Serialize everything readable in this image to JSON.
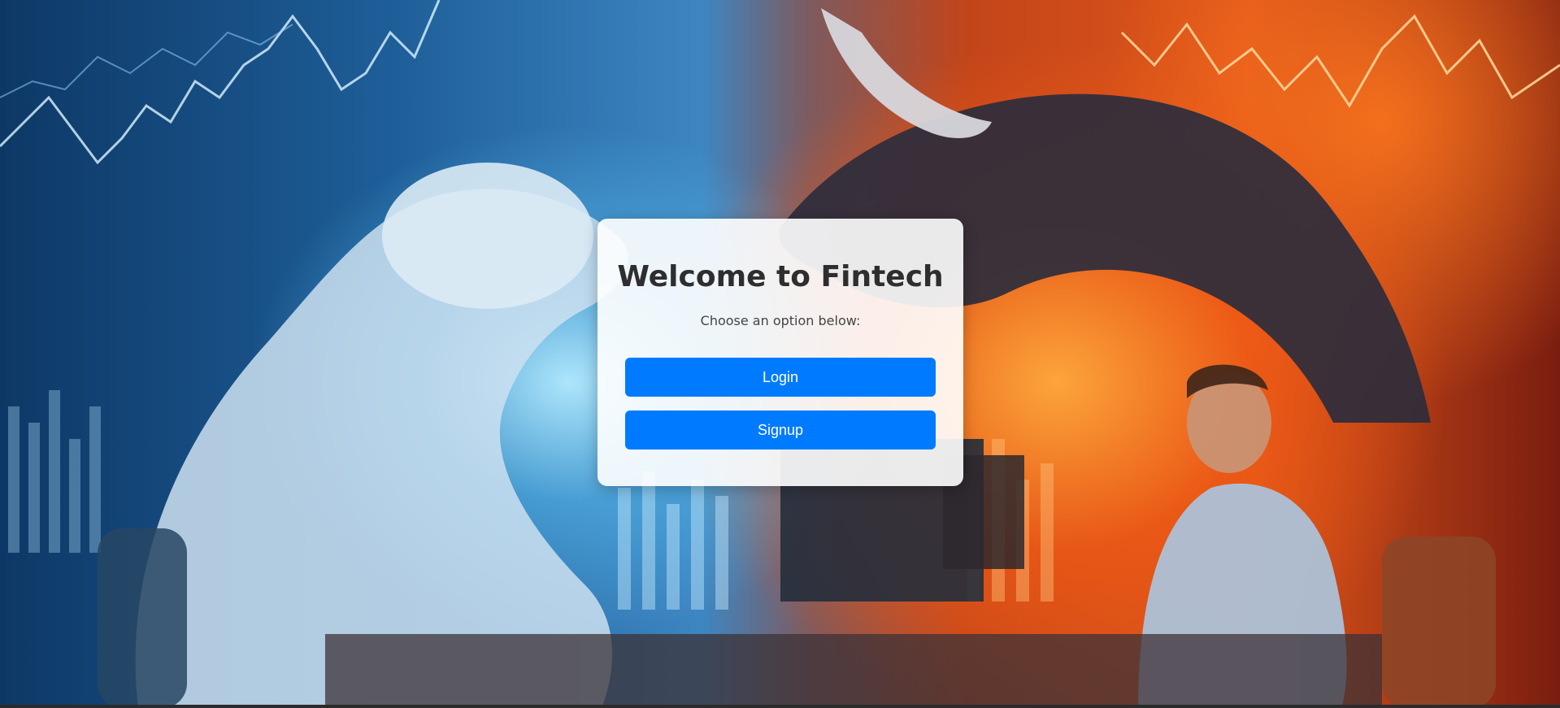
{
  "welcome": {
    "title": "Welcome to Fintech",
    "subtitle": "Choose an option below:"
  },
  "actions": {
    "login_label": "Login",
    "signup_label": "Signup"
  },
  "background": {
    "subject": "bear-vs-bull-market-illustration"
  },
  "colors": {
    "button_primary": "#007bff",
    "button_text": "#ffffff",
    "title_text": "#2e2e2e",
    "card_background": "#ffffff"
  }
}
